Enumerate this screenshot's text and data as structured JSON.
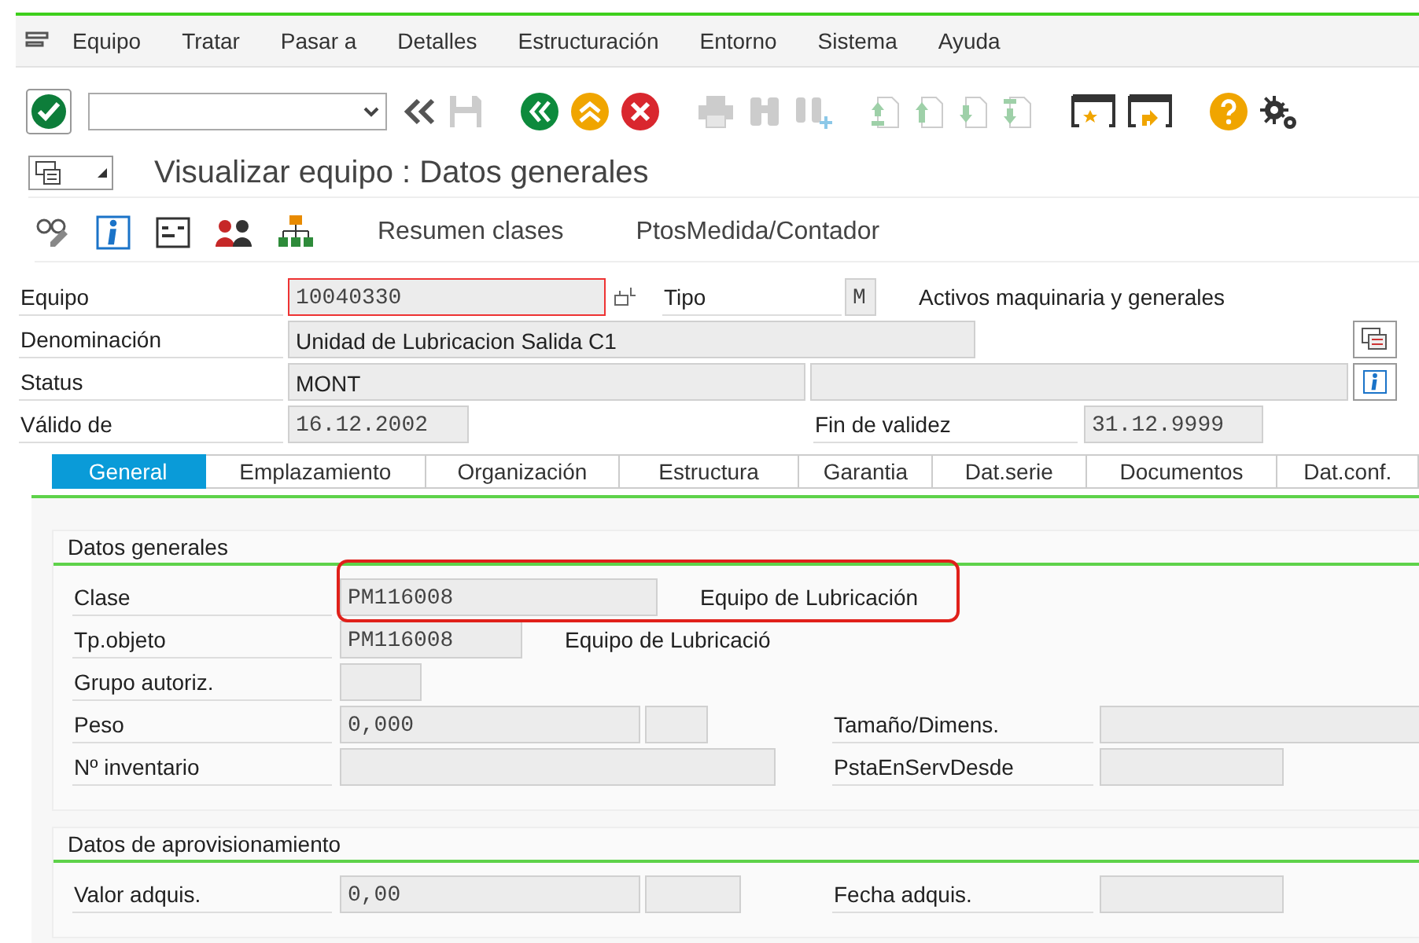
{
  "menu": [
    "Equipo",
    "Tratar",
    "Pasar a",
    "Detalles",
    "Estructuración",
    "Entorno",
    "Sistema",
    "Ayuda"
  ],
  "title": "Visualizar equipo : Datos generales",
  "app_toolbar": {
    "buttons": [
      "Resumen clases",
      "PtosMedida/Contador"
    ]
  },
  "header": {
    "items": [
      {
        "kind": "label",
        "text": "Equipo"
      },
      {
        "kind": "field",
        "value": "10040330",
        "focused": true
      },
      {
        "kind": "pick_button"
      },
      {
        "kind": "label",
        "text": "Tipo"
      },
      {
        "kind": "field",
        "value": "M"
      },
      {
        "kind": "text",
        "text": "Activos maquinaria y generales"
      },
      {
        "kind": "label",
        "text": "Denominación"
      },
      {
        "kind": "textfield",
        "value": "Unidad de Lubricacion Salida C1"
      },
      {
        "kind": "detail_button"
      },
      {
        "kind": "label",
        "text": "Status"
      },
      {
        "kind": "textfield",
        "value": "MONT"
      },
      {
        "kind": "field"
      },
      {
        "kind": "info_button"
      },
      {
        "kind": "label",
        "text": "Válido de"
      },
      {
        "kind": "field",
        "value": "16.12.2002"
      },
      {
        "kind": "label",
        "text": "Fin de validez"
      },
      {
        "kind": "field",
        "value": "31.12.9999"
      }
    ]
  },
  "tabs": [
    {
      "label": "General",
      "selected": true
    },
    {
      "label": "Emplazamiento",
      "selected": false
    },
    {
      "label": "Organización",
      "selected": false
    },
    {
      "label": "Estructura",
      "selected": false
    },
    {
      "label": "Garantia",
      "selected": false
    },
    {
      "label": "Dat.serie",
      "selected": false
    },
    {
      "label": "Documentos",
      "selected": false
    },
    {
      "label": "Dat.conf.",
      "selected": false
    }
  ],
  "groups": [
    {
      "title": "Datos generales",
      "items": [
        {
          "kind": "label",
          "text": "Clase"
        },
        {
          "kind": "field",
          "value": "PM116008"
        },
        {
          "kind": "text",
          "text": "Equipo de Lubricación"
        },
        {
          "kind": "label",
          "text": "Tp.objeto"
        },
        {
          "kind": "field",
          "value": "PM116008"
        },
        {
          "kind": "text",
          "text": "Equipo de Lubricació"
        },
        {
          "kind": "label",
          "text": "Grupo autoriz."
        },
        {
          "kind": "field"
        },
        {
          "kind": "label",
          "text": "Peso"
        },
        {
          "kind": "field",
          "value": "0,000"
        },
        {
          "kind": "field"
        },
        {
          "kind": "label",
          "text": "Tamaño/Dimens."
        },
        {
          "kind": "field"
        },
        {
          "kind": "label",
          "text": "Nº inventario"
        },
        {
          "kind": "field"
        },
        {
          "kind": "label",
          "text": "PstaEnServDesde"
        },
        {
          "kind": "field"
        }
      ]
    },
    {
      "title": "Datos de aprovisionamiento",
      "items": [
        {
          "kind": "label",
          "text": "Valor adquis."
        },
        {
          "kind": "field",
          "value": "0,00"
        },
        {
          "kind": "field"
        },
        {
          "kind": "label",
          "text": "Fecha adquis."
        },
        {
          "kind": "field"
        }
      ]
    }
  ]
}
